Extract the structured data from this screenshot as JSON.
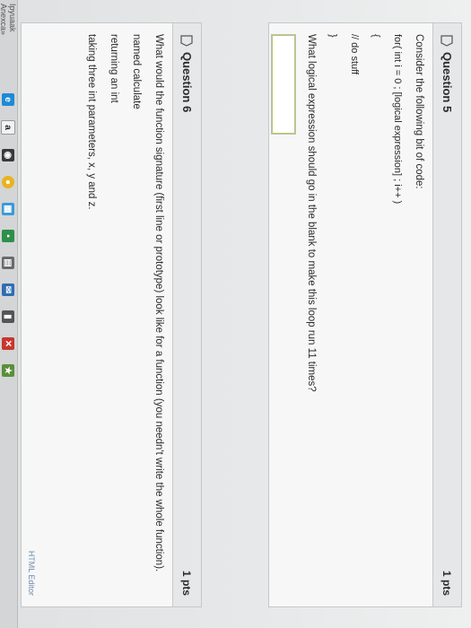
{
  "question5": {
    "title": "Question 5",
    "points": "1 pts",
    "prompt": "Consider the following bit of code:",
    "code_line1": "for( int i = 0 ; [logical expression] ; i++ )",
    "code_line2": "{",
    "code_line3": "// do stuff",
    "code_line4": "}",
    "question_text": "What logical expression should go in the blank to make this loop run 11 times?",
    "answer_value": ""
  },
  "question6": {
    "title": "Question 6",
    "points": "1 pts",
    "question_text": "What would the function signature (first line or prototype) look like for a function (you needn't write the whole function).",
    "line1": "named calculate",
    "line2": "returning an int",
    "line3": "taking three int parameters, x, y and z.",
    "editor_link": "HTML Editor"
  },
  "taskbar": {
    "label": "Ipyuaak Anexca»",
    "icons": [
      "ie-icon",
      "amazon-icon",
      "camera-icon",
      "chrome-icon",
      "store-icon",
      "grid-icon",
      "mail-icon",
      "video-icon",
      "tool-icon",
      "app-icon"
    ]
  }
}
